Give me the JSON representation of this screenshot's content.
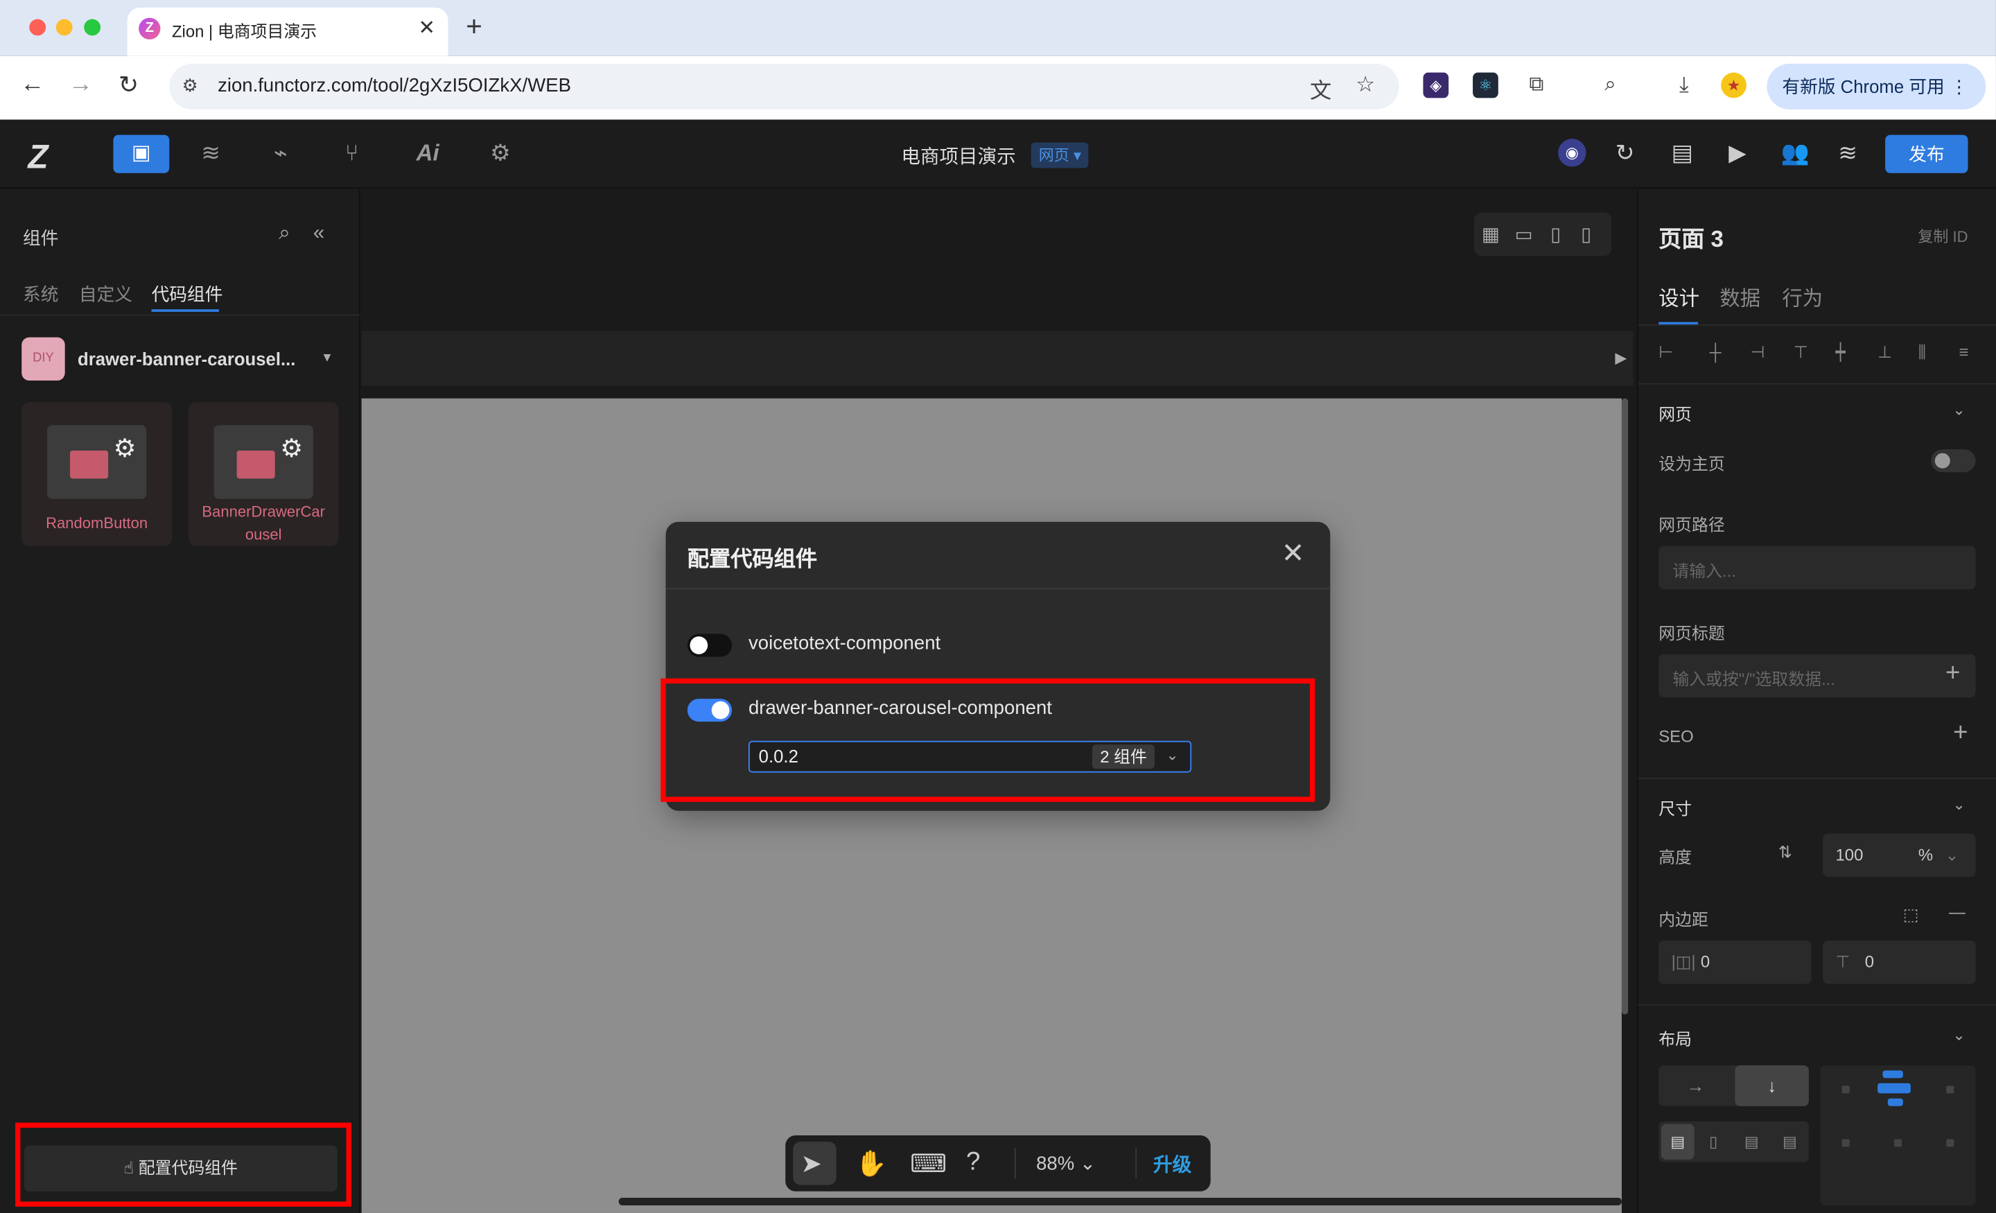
{
  "browser": {
    "tab_title": "Zion | 电商项目演示",
    "tab_favicon": "Z",
    "url": "zion.functorz.com/tool/2gXzI5OIZkX/WEB",
    "update_button": "有新版 Chrome 可用"
  },
  "app": {
    "project_title": "电商项目演示",
    "project_badge": "网页 ▾",
    "publish_label": "发布"
  },
  "left_panel": {
    "title": "组件",
    "tabs": [
      "系统",
      "自定义",
      "代码组件"
    ],
    "library_icon": "DIY",
    "library_name": "drawer-banner-carousel...",
    "components": [
      {
        "label": "RandomButton"
      },
      {
        "label": "BannerDrawerCar\nousel"
      }
    ],
    "config_button": "配置代码组件"
  },
  "canvas": {
    "zoom": "88%",
    "upgrade": "升级"
  },
  "modal": {
    "title": "配置代码组件",
    "items": [
      {
        "name": "voicetotext-component",
        "enabled": false
      },
      {
        "name": "drawer-banner-carousel-component",
        "enabled": true
      }
    ],
    "version": "0.0.2",
    "version_badge": "2 组件"
  },
  "right_panel": {
    "title": "页面 3",
    "copy_id": "复制 ID",
    "tabs": [
      "设计",
      "数据",
      "行为"
    ],
    "webpage_section": "网页",
    "set_home": "设为主页",
    "path_label": "网页路径",
    "path_placeholder": "请输入...",
    "page_title_label": "网页标题",
    "page_title_placeholder": "输入或按\"/\"选取数据...",
    "seo_label": "SEO",
    "size_section": "尺寸",
    "height_label": "高度",
    "height_value": "100",
    "height_unit": "%",
    "padding_label": "内边距",
    "padding_h": "0",
    "padding_v": "0",
    "layout_section": "布局"
  }
}
